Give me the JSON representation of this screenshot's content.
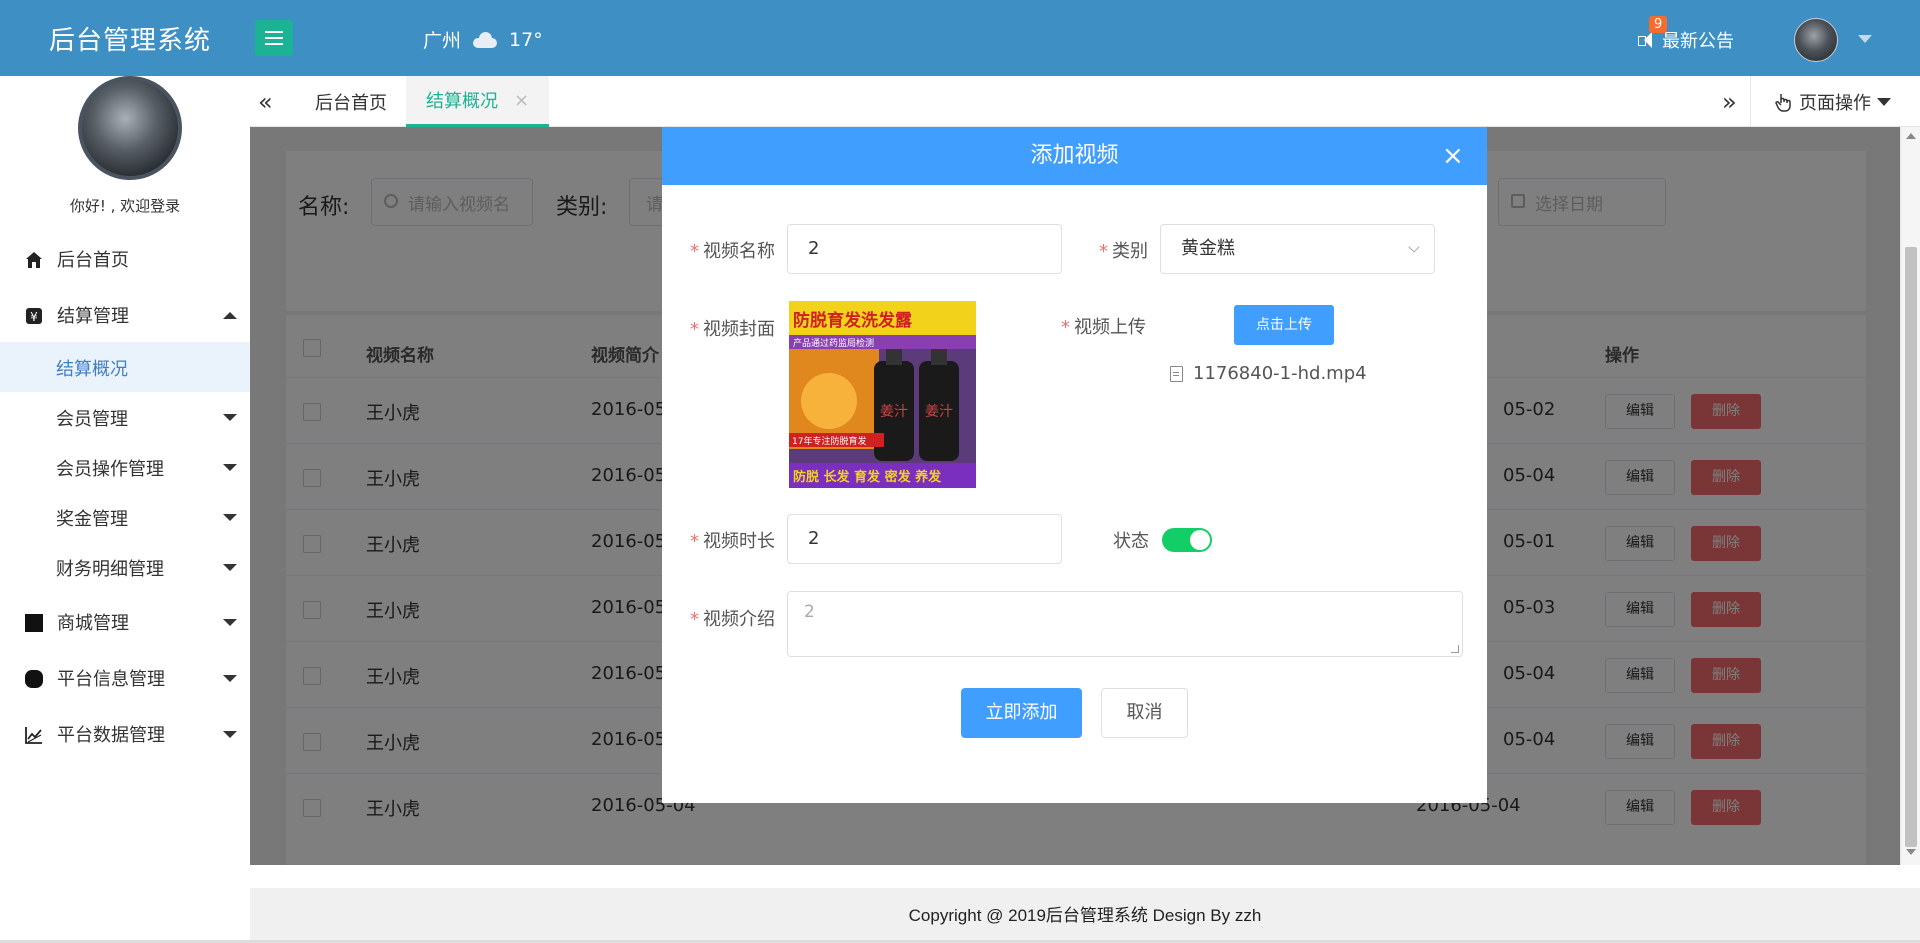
{
  "header": {
    "logo": "后台管理系统",
    "city": "广州",
    "temp": "17°",
    "notice_label": "最新公告",
    "notice_count": "9"
  },
  "sidebar": {
    "welcome": "你好! , 欢迎登录",
    "items": [
      {
        "label": "后台首页"
      },
      {
        "label": "结算管理"
      },
      {
        "label": "结算概况"
      },
      {
        "label": "会员管理"
      },
      {
        "label": "会员操作管理"
      },
      {
        "label": "奖金管理"
      },
      {
        "label": "财务明细管理"
      },
      {
        "label": "商城管理"
      },
      {
        "label": "平台信息管理"
      },
      {
        "label": "平台数据管理"
      }
    ]
  },
  "tabs": {
    "items": [
      {
        "label": "后台首页"
      },
      {
        "label": "结算概况"
      }
    ],
    "page_ops": "页面操作"
  },
  "filters": {
    "name_label": "名称:",
    "name_placeholder": "请输入视频名",
    "type_label": "类别:",
    "type_placeholder": "请",
    "date_placeholder": "选择日期"
  },
  "table": {
    "headers": [
      "视频名称",
      "视频简介",
      "操作"
    ],
    "rows": [
      {
        "name": "王小虎",
        "date": "2016-05",
        "end": "05-02"
      },
      {
        "name": "王小虎",
        "date": "2016-05",
        "end": "05-04"
      },
      {
        "name": "王小虎",
        "date": "2016-05",
        "end": "05-01"
      },
      {
        "name": "王小虎",
        "date": "2016-05",
        "end": "05-03"
      },
      {
        "name": "王小虎",
        "date": "2016-05",
        "end": "05-04"
      },
      {
        "name": "王小虎",
        "date": "2016-05",
        "end": "05-04"
      },
      {
        "name": "王小虎",
        "date": "2016-05-04",
        "end": "2016-05-04"
      }
    ],
    "edit_label": "编辑",
    "delete_label": "删除"
  },
  "modal": {
    "title": "添加视频",
    "name_label": "视频名称",
    "name_value": "2",
    "type_label": "类别",
    "type_value": "黄金糕",
    "cover_label": "视频封面",
    "upload_label": "视频上传",
    "upload_button": "点击上传",
    "file_name": "1176840-1-hd.mp4",
    "duration_label": "视频时长",
    "duration_value": "2",
    "status_label": "状态",
    "status_on": true,
    "intro_label": "视频介绍",
    "intro_value": "2",
    "submit": "立即添加",
    "cancel": "取消",
    "cover_text": {
      "title": "防脱育发洗发露",
      "line1": "产品通过药监局检测",
      "tag": "17年专注防脱育发",
      "bottom": "防脱 长发 育发 密发 养发",
      "brand": "姜汁"
    }
  },
  "footer": {
    "text": "Copyright @ 2019后台管理系统 Design By zzh"
  },
  "colors": {
    "header_bg": "#3d8fc4",
    "accent": "#1bb394",
    "primary": "#409eff",
    "danger": "#f56c6c",
    "toggle_on": "#13ce66"
  }
}
